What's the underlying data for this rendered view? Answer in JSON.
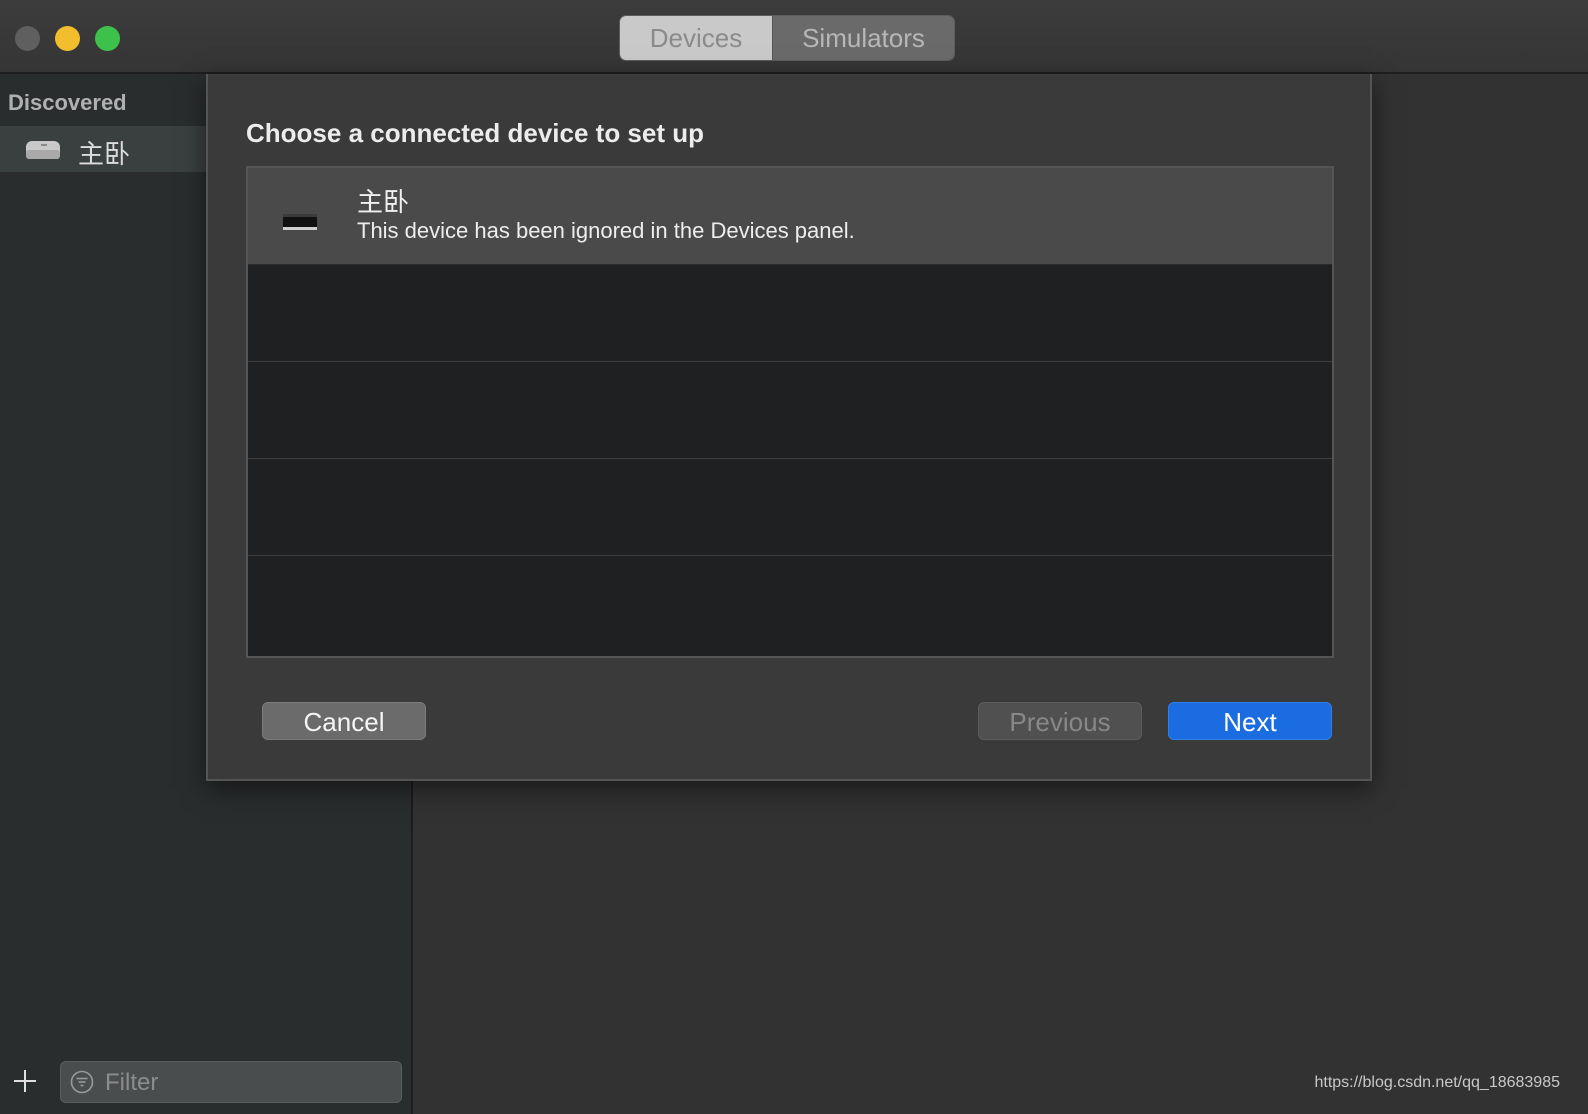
{
  "titlebar": {
    "tabs": [
      {
        "label": "Devices",
        "selected": true
      },
      {
        "label": "Simulators",
        "selected": false
      }
    ]
  },
  "sidebar": {
    "section_header": "Discovered",
    "items": [
      {
        "label": "主卧",
        "icon": "apple-tv-icon",
        "selected": true
      }
    ],
    "filter": {
      "placeholder": "Filter",
      "value": ""
    }
  },
  "sheet": {
    "title": "Choose a connected device to set up",
    "devices": [
      {
        "name": "主卧",
        "description": "This device has been ignored in the Devices panel.",
        "icon": "apple-tv-icon",
        "selected": true
      }
    ],
    "buttons": {
      "cancel": "Cancel",
      "previous": "Previous",
      "next": "Next"
    }
  },
  "footer": {
    "watermark": "https://blog.csdn.net/qq_18683985"
  },
  "colors": {
    "accent": "#1a6ce0",
    "close": "#5f5f5f",
    "minimize": "#f2be2e",
    "maximize": "#3ec14a"
  }
}
